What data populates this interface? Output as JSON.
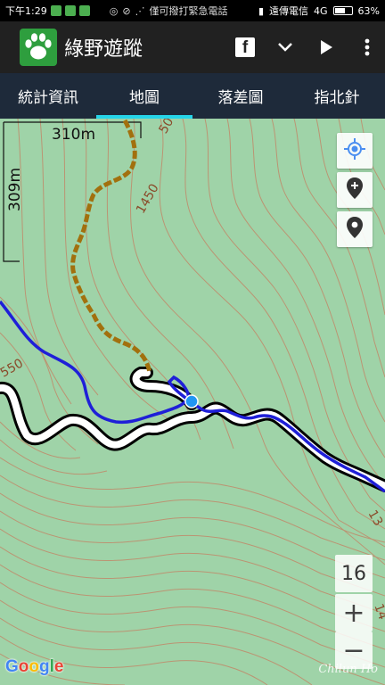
{
  "status_bar": {
    "time": "下午1:29",
    "carrier_notice": "僅可撥打緊急電話",
    "carrier": "遠傳電信",
    "network": "4G",
    "battery_text": "63%",
    "battery_level": 0.63
  },
  "app": {
    "title": "綠野遊蹤",
    "facebook_label": "f"
  },
  "tabs": [
    {
      "label": "統計資訊",
      "active": false
    },
    {
      "label": "地圖",
      "active": true
    },
    {
      "label": "落差圖",
      "active": false
    },
    {
      "label": "指北針",
      "active": false
    }
  ],
  "map": {
    "scale_horizontal": "310m",
    "scale_vertical": "309m",
    "contour_labels": [
      "1450",
      "550",
      "13",
      "14",
      "50"
    ],
    "zoom_level": "16",
    "zoom_in_label": "+",
    "zoom_out_label": "−",
    "attribution": [
      "G",
      "o",
      "o",
      "g",
      "l",
      "e"
    ],
    "attribution_colors": [
      "#4285F4",
      "#EA4335",
      "#FBBC05",
      "#4285F4",
      "#34A853",
      "#EA4335"
    ],
    "watermark": "Chilun Ho",
    "colors": {
      "terrain": "#9fd3a8",
      "contour": "#c08a6a",
      "track_brown": "#a2700e",
      "track_blue": "#1f1fd8",
      "road_outline": "#000000",
      "road_fill": "#ffffff",
      "location_dot": "#2196f3"
    }
  },
  "icons": {
    "locate": "crosshair-icon",
    "add_marker": "add-marker-icon",
    "marker": "location-pin-icon",
    "share": "facebook-icon",
    "dropdown": "chevron-down-icon",
    "play": "play-icon",
    "overflow": "more-vert-icon"
  }
}
